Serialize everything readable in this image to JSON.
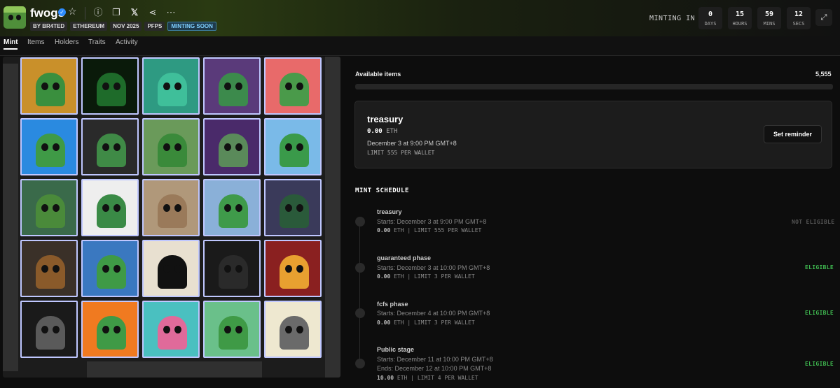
{
  "collection": {
    "name": "fwogs",
    "tags": [
      "BY BR4TED",
      "ETHEREUM",
      "NOV 2025",
      "PFPS",
      "MINTING SOON"
    ]
  },
  "countdown": {
    "label": "MINTING IN",
    "units": [
      {
        "value": "0",
        "unit": "DAYS"
      },
      {
        "value": "15",
        "unit": "HOURS"
      },
      {
        "value": "59",
        "unit": "MINS"
      },
      {
        "value": "12",
        "unit": "SECS"
      }
    ]
  },
  "tabs": [
    "Mint",
    "Items",
    "Holders",
    "Traits",
    "Activity"
  ],
  "available": {
    "label": "Available items",
    "value": "5,555"
  },
  "current_phase": {
    "name": "treasury",
    "price": "0.00",
    "currency": "ETH",
    "date": "December 3 at 9:00 PM GMT+8",
    "limit": "LIMIT 555 PER WALLET",
    "reminder_label": "Set reminder"
  },
  "schedule": {
    "title": "MINT SCHEDULE",
    "phases": [
      {
        "name": "treasury",
        "start": "Starts: December 3 at 9:00 PM GMT+8",
        "end": "",
        "price": "0.00",
        "detail": "ETH | LIMIT 555 PER WALLET",
        "status": "NOT ELIGIBLE"
      },
      {
        "name": "guaranteed phase",
        "start": "Starts: December 3 at 10:00 PM GMT+8",
        "end": "",
        "price": "0.00",
        "detail": "ETH | LIMIT 3 PER WALLET",
        "status": "ELIGIBLE"
      },
      {
        "name": "fcfs phase",
        "start": "Starts: December 4 at 10:00 PM GMT+8",
        "end": "",
        "price": "0.00",
        "detail": "ETH | LIMIT 3 PER WALLET",
        "status": "ELIGIBLE"
      },
      {
        "name": "Public stage",
        "start": "Starts: December 11 at 10:00 PM GMT+8",
        "end": "Ends: December 12 at 10:00 PM GMT+8",
        "price": "10.00",
        "detail": "ETH | LIMIT 4 PER WALLET",
        "status": "ELIGIBLE"
      }
    ]
  },
  "gallery_tiles": [
    {
      "bg": "#c9902a",
      "frog": "#3a8f3e"
    },
    {
      "bg": "#0a1a0a",
      "frog": "#1e6b2a"
    },
    {
      "bg": "#2e9a82",
      "frog": "#3fbf9a"
    },
    {
      "bg": "#5a3a7a",
      "frog": "#3c8a4c"
    },
    {
      "bg": "#e86a6a",
      "frog": "#4a9a4a"
    },
    {
      "bg": "#2a8ae0",
      "frog": "#3f9a46"
    },
    {
      "bg": "#2a2a2a",
      "frog": "#3f8a46"
    },
    {
      "bg": "#6a9a5a",
      "frog": "#3a8a3a"
    },
    {
      "bg": "#4a2a6a",
      "frog": "#5a8a5a"
    },
    {
      "bg": "#7abae8",
      "frog": "#3a9a4a"
    },
    {
      "bg": "#3a6a4a",
      "frog": "#4a8a3a"
    },
    {
      "bg": "#eeeeee",
      "frog": "#3a8a46"
    },
    {
      "bg": "#b0987a",
      "frog": "#9a7a5a"
    },
    {
      "bg": "#8ab0d8",
      "frog": "#3f9a4a"
    },
    {
      "bg": "#3a3a5a",
      "frog": "#2a5a3a"
    },
    {
      "bg": "#3a3028",
      "frog": "#8a5a2a"
    },
    {
      "bg": "#3a78c0",
      "frog": "#3f9a46"
    },
    {
      "bg": "#e8e0d0",
      "frog": "#111111"
    },
    {
      "bg": "#1a1a1a",
      "frog": "#2a2a2a"
    },
    {
      "bg": "#8a2020",
      "frog": "#e8a030"
    },
    {
      "bg": "#1a1a1a",
      "frog": "#5a5a5a"
    },
    {
      "bg": "#f07a20",
      "frog": "#3f9a46"
    },
    {
      "bg": "#4ac0c0",
      "frog": "#e06a9a"
    },
    {
      "bg": "#6ac08a",
      "frog": "#3f9a46"
    },
    {
      "bg": "#eee8d0",
      "frog": "#6a6a6a"
    }
  ]
}
